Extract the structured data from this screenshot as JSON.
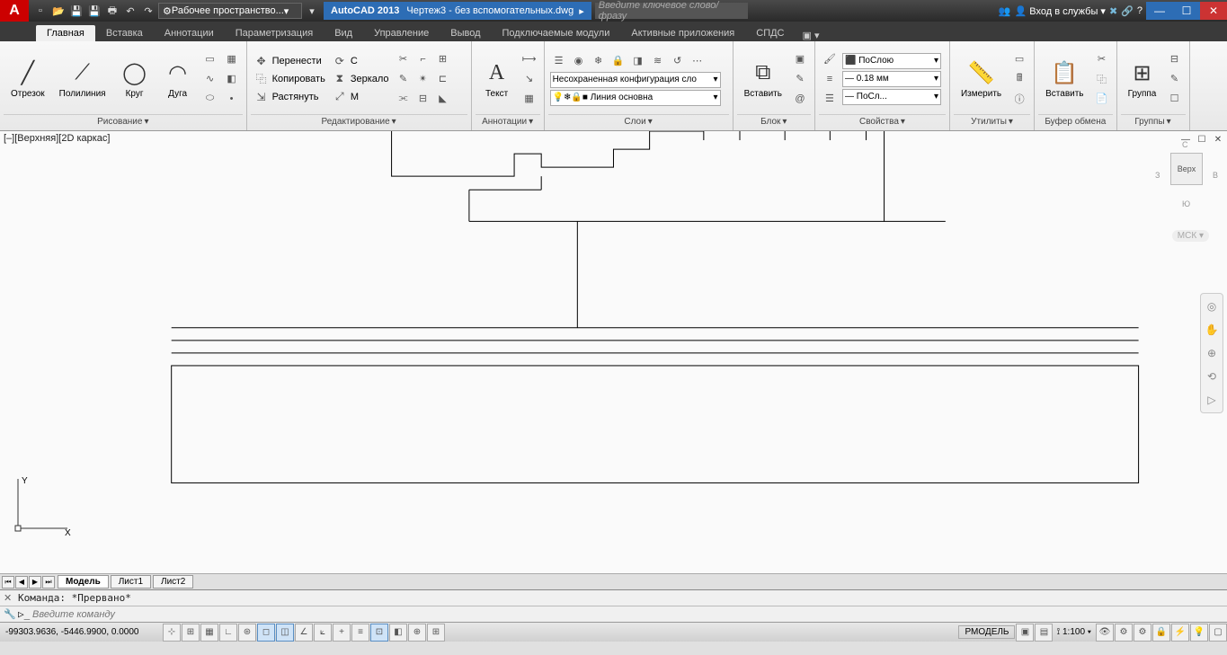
{
  "title": {
    "app": "AutoCAD 2013",
    "doc": "Чертеж3 - без вспомогательных.dwg",
    "workspace": "Рабочее пространство...",
    "search_ph": "Введите ключевое слово/фразу",
    "signin": "Вход в службы"
  },
  "tabs": [
    "Главная",
    "Вставка",
    "Аннотации",
    "Параметризация",
    "Вид",
    "Управление",
    "Вывод",
    "Подключаемые модули",
    "Активные приложения",
    "СПДС"
  ],
  "active_tab": 0,
  "draw": {
    "line": "Отрезок",
    "pline": "Полилиния",
    "circle": "Круг",
    "arc": "Дуга",
    "title": "Рисование"
  },
  "modify": {
    "move": "Перенести",
    "copy": "Копировать",
    "stretch": "Растянуть",
    "rotate": "С",
    "mirror": "Зеркало",
    "scale": "М",
    "title": "Редактирование"
  },
  "anno": {
    "text": "Текст",
    "title": "Аннотации"
  },
  "layers": {
    "config": "Несохраненная конфигурация сло",
    "current": "Линия основна",
    "title": "Слои"
  },
  "block": {
    "insert": "Вставить",
    "title": "Блок"
  },
  "props": {
    "color": "ПоСлою",
    "lw": "0.18 мм",
    "lt": "ПоСл...",
    "title": "Свойства"
  },
  "util": {
    "measure": "Измерить",
    "title": "Утилиты"
  },
  "clip": {
    "paste": "Вставить",
    "title": "Буфер обмена"
  },
  "group": {
    "group": "Группа",
    "title": "Группы"
  },
  "view": {
    "label": "[–][Верхняя][2D каркас]",
    "cube_top": "Верх",
    "cube_n": "С",
    "cube_s": "Ю",
    "cube_e": "В",
    "cube_w": "З",
    "mck": "МСК",
    "ucs_x": "X",
    "ucs_y": "Y"
  },
  "layouts": {
    "model": "Модель",
    "l1": "Лист1",
    "l2": "Лист2"
  },
  "cmd": {
    "hist": "Команда:  *Прервано*",
    "ph": "Введите команду"
  },
  "status": {
    "coords": "-99303.9636, -5446.9900, 0.0000",
    "space": "РМОДЕЛЬ",
    "scale": "1:100"
  }
}
